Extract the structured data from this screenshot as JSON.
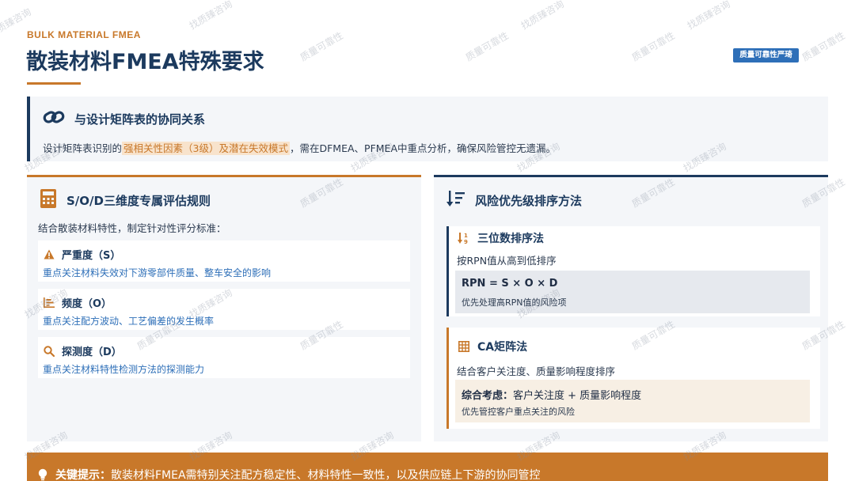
{
  "header": {
    "eyebrow": "BULK MATERIAL FMEA",
    "title": "散装材料FMEA特殊要求",
    "badge": "质量可靠性严琦"
  },
  "relation_card": {
    "icon": "link-icon",
    "title": "与设计矩阵表的协同关系",
    "desc_prefix": "设计矩阵表识别的",
    "desc_highlight": "强相关性因素（3级）及潜在失效模式",
    "desc_suffix": "，需在DFMEA、PFMEA中重点分析，确保风险管控无遗漏。"
  },
  "sod_section": {
    "icon": "calculator-icon",
    "title": "S/O/D三维度专属评估规则",
    "intro": "结合散装材料特性，制定针对性评分标准：",
    "items": [
      {
        "icon": "warning-icon",
        "title": "严重度（S）",
        "desc": "重点关注材料失效对下游零部件质量、整车安全的影响"
      },
      {
        "icon": "bar-chart-icon",
        "title": "频度（O）",
        "desc": "重点关注配方波动、工艺偏差的发生概率"
      },
      {
        "icon": "search-icon",
        "title": "探测度（D）",
        "desc": "重点关注材料特性检测方法的探测能力"
      }
    ]
  },
  "priority_section": {
    "icon": "sort-descending-icon",
    "title": "风险优先级排序方法",
    "methods": [
      {
        "icon": "sort-numeric-icon",
        "title": "三位数排序法",
        "desc": "按RPN值从高到低排序",
        "formula": "RPN = S × O × D",
        "note": "优先处理高RPN值的风险项"
      },
      {
        "icon": "grid-table-icon",
        "title": "CA矩阵法",
        "desc": "结合客户关注度、质量影响程度排序",
        "formula_label": "综合考虑：",
        "formula": "客户关注度 + 质量影响程度",
        "note": "优先管控客户重点关注的风险"
      }
    ]
  },
  "footer": {
    "icon": "lightbulb-icon",
    "label": "关键提示：",
    "text": "散装材料FMEA需特别关注配方稳定性、材料特性一致性，以及供应链上下游的协同管控"
  },
  "watermark": {
    "text_a": "质量可靠性",
    "text_b": "找质臻咨询"
  },
  "colors": {
    "navy": "#1c3a5e",
    "accent": "#c8782a",
    "blue": "#2e6fb8",
    "panel": "#f4f6f9"
  }
}
